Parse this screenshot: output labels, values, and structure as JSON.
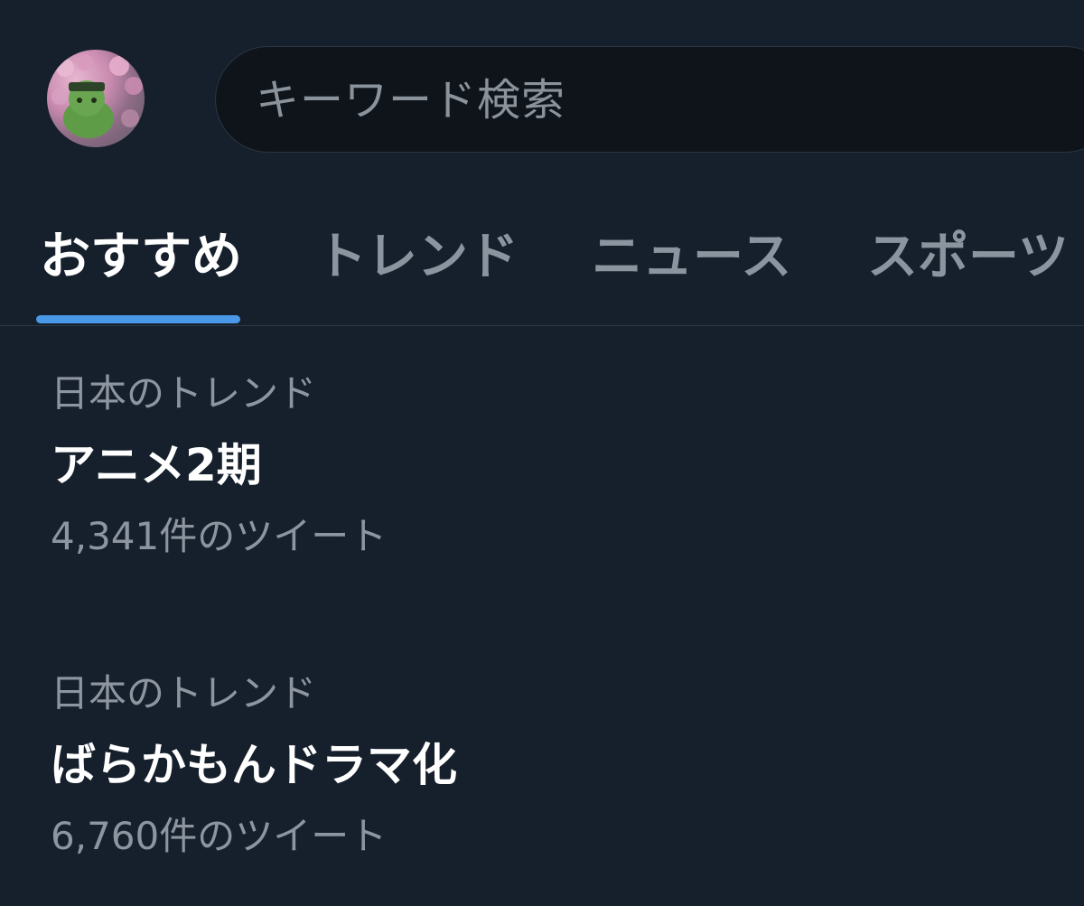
{
  "search": {
    "placeholder": "キーワード検索"
  },
  "tabs": [
    {
      "label": "おすすめ",
      "active": true
    },
    {
      "label": "トレンド",
      "active": false
    },
    {
      "label": "ニュース",
      "active": false
    },
    {
      "label": "スポーツ",
      "active": false
    }
  ],
  "trends": [
    {
      "context": "日本のトレンド",
      "title": "アニメ2期",
      "count": "4,341件のツイート"
    },
    {
      "context": "日本のトレンド",
      "title": "ばらかもんドラマ化",
      "count": "6,760件のツイート"
    }
  ],
  "colors": {
    "background": "#16202c",
    "accent": "#4a99e9",
    "muted_text": "#8d96a0"
  },
  "icons": {
    "avatar": "profile-avatar"
  }
}
